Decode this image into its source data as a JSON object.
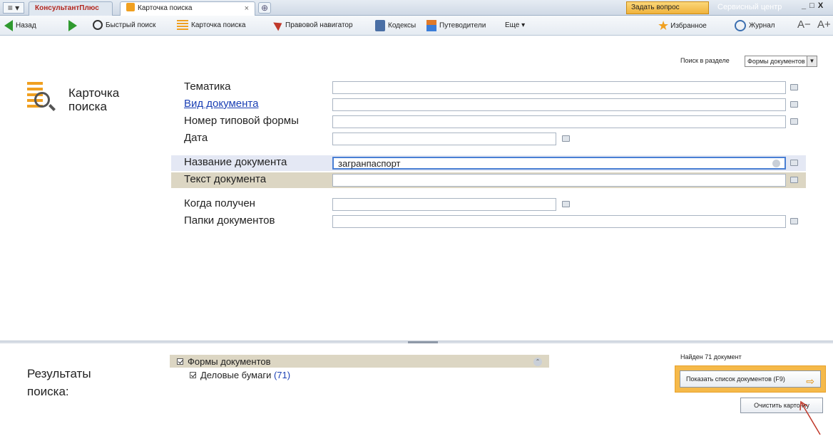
{
  "titlebar": {
    "menu_label": "≡ ▾",
    "brand_tab": "КонсультантПлюс",
    "active_tab": "Карточка поиска",
    "tab_close": "×",
    "new_tab": "⊕",
    "ask_button": "Задать вопрос",
    "service_button": "Сервисный центр",
    "window_controls": "_ □ X"
  },
  "toolbar": {
    "back": "Назад",
    "quick_search": "Быстрый поиск",
    "search_card": "Карточка поиска",
    "legal_navigator": "Правовой навигатор",
    "codes": "Кодексы",
    "guides": "Путеводители",
    "more": "Еще ▾",
    "favorites": "Избранное",
    "journal": "Журнал",
    "font_smaller": "A−",
    "font_larger": "A+"
  },
  "search": {
    "section_label": "Поиск в разделе",
    "section_value": "Формы документов",
    "card_title": "Карточка поиска",
    "fields": [
      {
        "label": "Тематика",
        "value": ""
      },
      {
        "label": "Вид документа",
        "value": ""
      },
      {
        "label": "Номер типовой формы",
        "value": ""
      },
      {
        "label": "Дата",
        "value": ""
      },
      {
        "label": "Название документа",
        "value": "загранпаспорт"
      },
      {
        "label": "Текст документа",
        "value": ""
      },
      {
        "label": "Когда получен",
        "value": ""
      },
      {
        "label": "Папки документов",
        "value": ""
      }
    ]
  },
  "results": {
    "label": "Результаты поиска:",
    "tree": [
      {
        "label": "Формы документов",
        "count": ""
      },
      {
        "label": "Деловые бумаги",
        "count": "(71)"
      }
    ],
    "found_text": "Найден 71 документ",
    "show_list_button": "Показать список документов (F9)",
    "clear_card_button": "Очистить карточку"
  },
  "colors": {
    "accent_orange": "#f5b94a",
    "link_blue": "#1a3fb4",
    "highlight_tan": "#dcd6c3",
    "highlight_blue": "#e4e8f4"
  }
}
